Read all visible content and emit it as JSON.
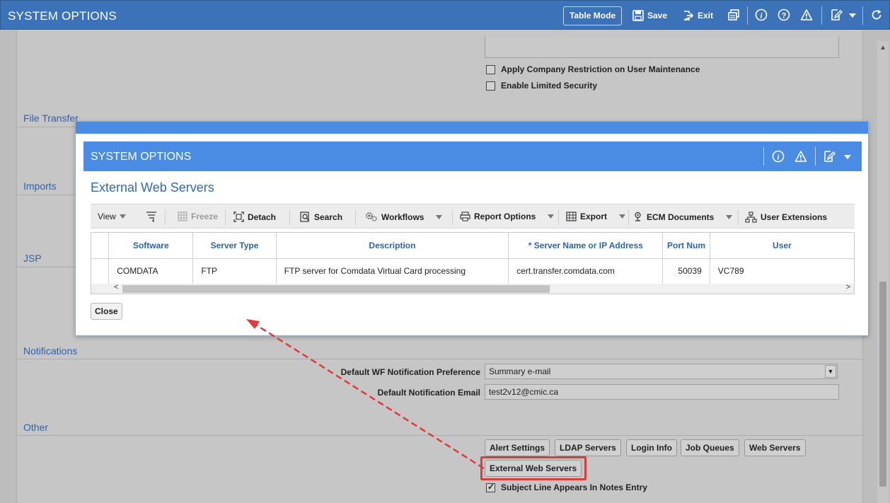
{
  "topbar": {
    "title": "SYSTEM OPTIONS",
    "table_mode": "Table Mode",
    "save": "Save",
    "exit": "Exit",
    "icons": [
      "save-icon",
      "exit-icon",
      "copy-icon",
      "info-icon",
      "help-icon",
      "warning-icon",
      "edit-icon",
      "chevron-down-icon",
      "refresh-icon"
    ]
  },
  "background": {
    "checkboxes": [
      {
        "label": "Apply Company Restriction on User Maintenance",
        "checked": false
      },
      {
        "label": "Enable Limited Security",
        "checked": false
      }
    ],
    "sections": [
      "File Transfer",
      "Imports",
      "JSP",
      "Notifications",
      "Other"
    ],
    "notifications": {
      "pref_label": "Default WF Notification Preference",
      "pref_value": "Summary e-mail",
      "email_label": "Default Notification Email",
      "email_value": "test2v12@cmic.ca"
    },
    "other_buttons": [
      "Alert Settings",
      "LDAP Servers",
      "Login Info",
      "Job Queues",
      "Web Servers",
      "External Web Servers"
    ],
    "subject_line": {
      "label": "Subject Line Appears In Notes Entry",
      "checked": true
    }
  },
  "modal": {
    "header_title": "SYSTEM OPTIONS",
    "subtitle": "External Web Servers",
    "toolbar": {
      "view": "View",
      "freeze": "Freeze",
      "detach": "Detach",
      "search": "Search",
      "workflows": "Workflows",
      "report_options": "Report Options",
      "export": "Export",
      "ecm_documents": "ECM Documents",
      "user_extensions": "User Extensions"
    },
    "table": {
      "columns": [
        "Software",
        "Server Type",
        "Description",
        "* Server Name or IP Address",
        "Port Num",
        "User"
      ],
      "rows": [
        [
          "COMDATA",
          "FTP",
          "FTP server for Comdata Virtual Card processing",
          "cert.transfer.comdata.com",
          "50039",
          "VC789"
        ]
      ]
    },
    "close": "Close"
  },
  "colors": {
    "topbar": "#3c73b8",
    "modal_header": "#4a8be3",
    "link_blue": "#2f62a8",
    "highlight_red": "#e23a3a"
  }
}
